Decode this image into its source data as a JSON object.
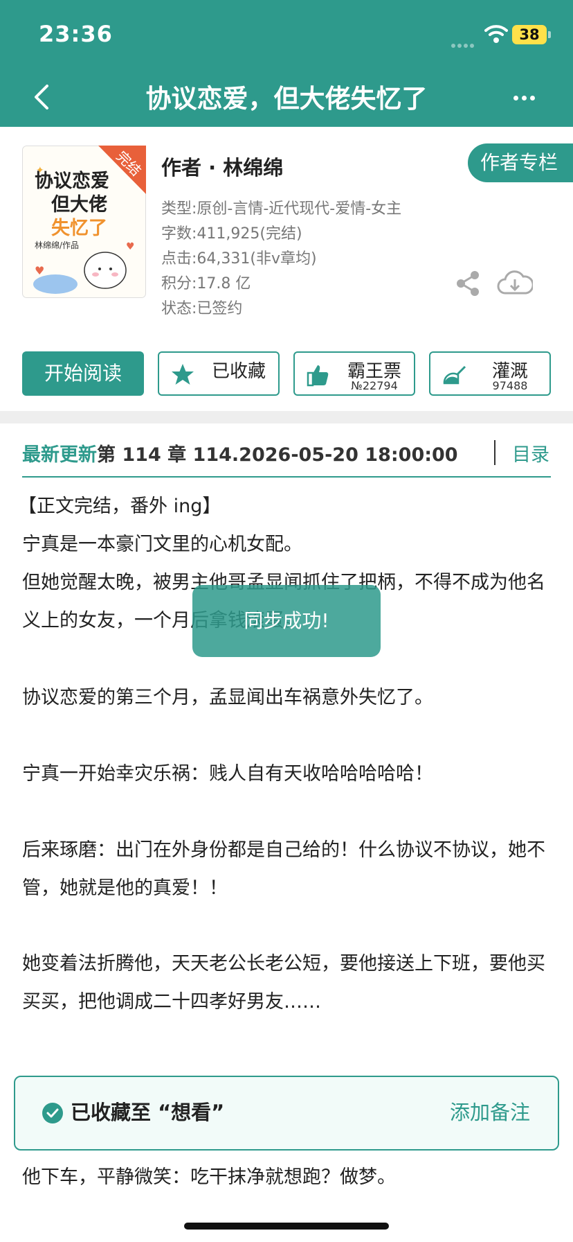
{
  "status_bar": {
    "time": "23:36",
    "battery": "38"
  },
  "header": {
    "title": "协议恋爱，但大佬失忆了"
  },
  "book": {
    "author": "作者 · 林绵绵",
    "author_column": "作者专栏",
    "cover_badge": "完结",
    "cover_title_lines": [
      "协议恋爱",
      "但大佬",
      "失忆了"
    ],
    "cover_author": "林绵绵/作品",
    "meta": [
      "类型:原创-言情-近代现代-爱情-女主",
      "字数:411,925(完结)",
      "点击:64,331(非v章均)",
      "积分:17.8 亿",
      "状态:已签约"
    ]
  },
  "actions": {
    "read": "开始阅读",
    "collect": {
      "label": "已收藏",
      "count": ""
    },
    "vote": {
      "label": "霸王票",
      "count": "№22794"
    },
    "water": {
      "label": "灌溉",
      "count": "97488"
    }
  },
  "latest": {
    "label": "最新更新",
    "value": "第 114 章 114.2026-05-20 18:00:00",
    "toc": "目录"
  },
  "summary": [
    "【正文完结，番外 ing】",
    "宁真是一本豪门文里的心机女配。",
    "但她觉醒太晚，被男主他哥孟显闻抓住了把柄，不得不成为他名义上的女友，一个月后拿钱滚蛋。",
    "协议恋爱的第三个月，孟显闻出车祸意外失忆了。",
    "宁真一开始幸灾乐祸：贱人自有天收哈哈哈哈哈！",
    "后来琢磨：出门在外身份都是自己给的！什么协议不协议，她不管，她就是他的真爱！！",
    "她变着法折腾他，天天老公长老公短，要他接送上下班，要他买买买，把他调成二十四孝好男友……",
    "他下车，平静微笑：吃干抹净就想跑？做梦。"
  ],
  "toast": "同步成功!",
  "saved_bar": {
    "text": "已收藏至 “想看”",
    "note": "添加备注"
  },
  "colors": {
    "accent": "#2e9a8c",
    "battery": "#ffe14a"
  },
  "icons": [
    "back-icon",
    "more-icon",
    "share-icon",
    "download-icon",
    "star-icon",
    "thumb-up-icon",
    "watering-can-icon",
    "check-circle-icon",
    "wifi-icon"
  ]
}
